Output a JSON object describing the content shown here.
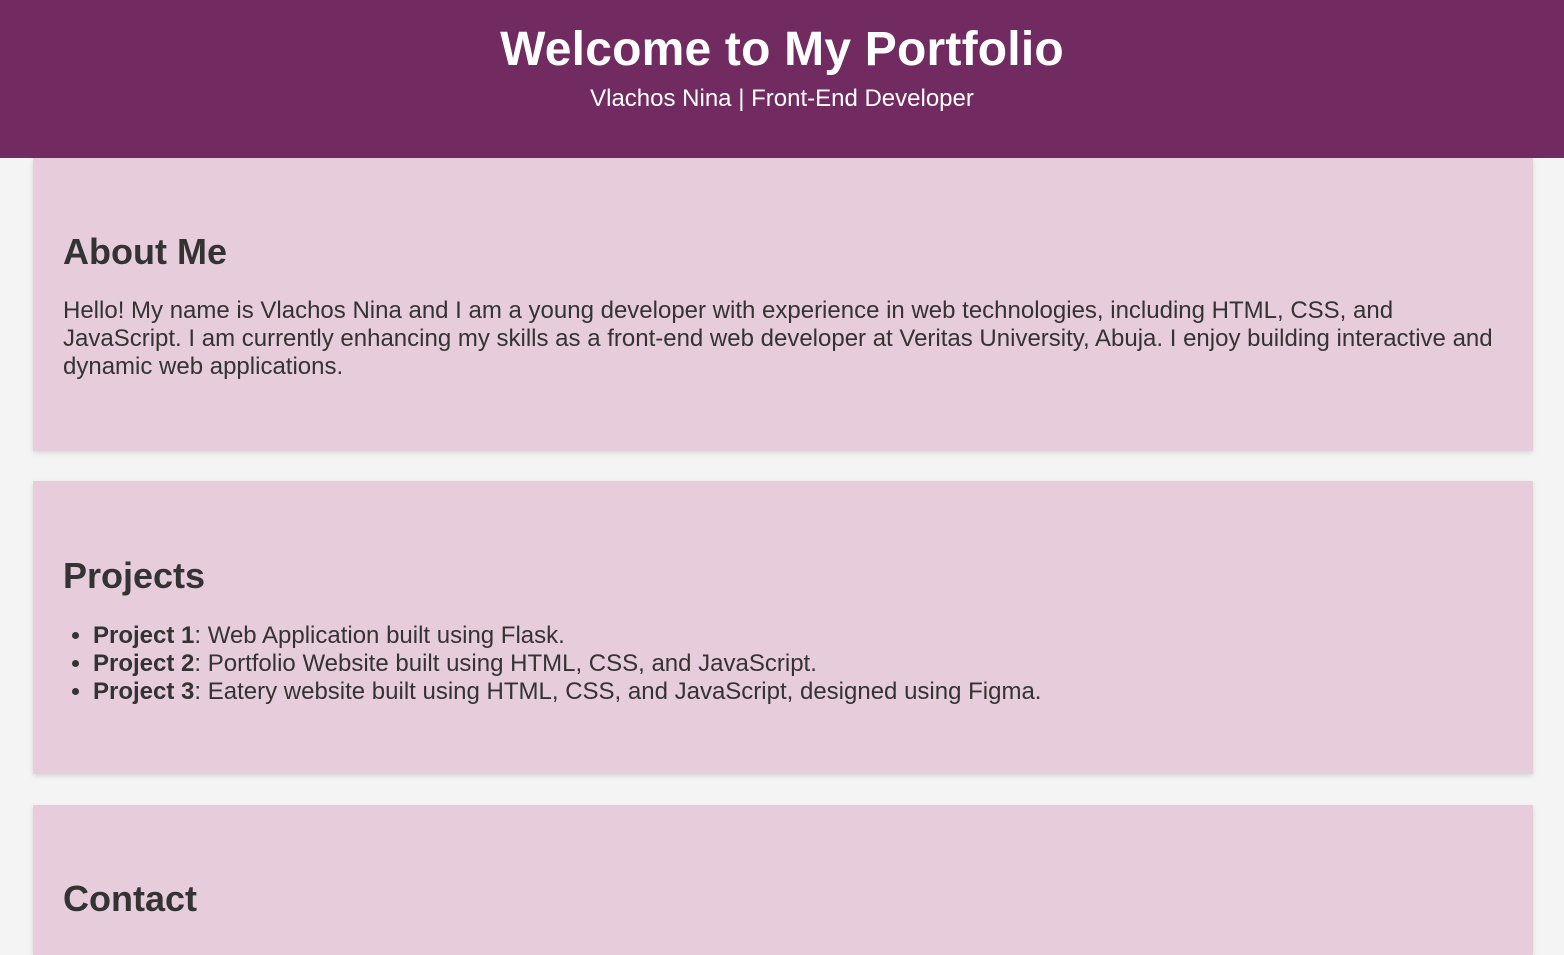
{
  "header": {
    "title": "Welcome to My Portfolio",
    "subtitle": "Vlachos Nina | Front-End Developer"
  },
  "about": {
    "heading": "About Me",
    "text": "Hello! My name is Vlachos Nina and I am a young developer with experience in web technologies, including HTML, CSS, and JavaScript. I am currently enhancing my skills as a front-end web developer at Veritas University, Abuja. I enjoy building interactive and dynamic web applications."
  },
  "projects": {
    "heading": "Projects",
    "items": [
      {
        "name": "Project 1",
        "description": ": Web Application built using Flask."
      },
      {
        "name": "Project 2",
        "description": ": Portfolio Website built using HTML, CSS, and JavaScript."
      },
      {
        "name": "Project 3",
        "description": ": Eatery website built using HTML, CSS, and JavaScript, designed using Figma."
      }
    ]
  },
  "contact": {
    "heading": "Contact"
  },
  "colors": {
    "header_bg": "#722b61",
    "section_bg": "#e7cddc",
    "page_bg": "#f4f4f4",
    "text": "#333333"
  }
}
